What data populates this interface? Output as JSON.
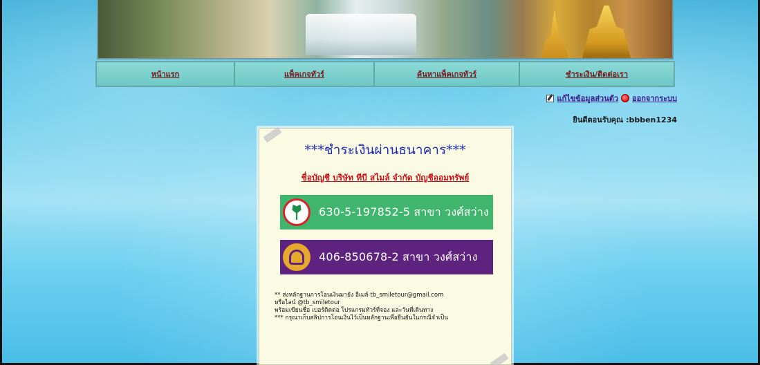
{
  "nav": {
    "items": [
      {
        "label": "หน้าแรก"
      },
      {
        "label": "แพ็คเกจทัวร์"
      },
      {
        "label": "ค้นหาแพ็คเกจทัวร์"
      },
      {
        "label": "ชำระเงิน/ติดต่อเรา"
      }
    ]
  },
  "user": {
    "edit_profile": "แก้ไขข้อมูลส่วนตัว",
    "logout": "ออกจากระบบ",
    "welcome": "ยินดีตอนรับคุณ :bbben1234"
  },
  "payment": {
    "title": "***ชำระเงินผ่านธนาคาร***",
    "account_name": "ชื่อบัญชี บริษัท ทีบี สไมล์ จำกัด  บัญชีออมทรัพย์",
    "banks": [
      {
        "text": "630-5-197852-5  สาขา วงศ์สว่าง",
        "color": "#3fb56d"
      },
      {
        "text": "406-850678-2  สาขา วงศ์สว่าง",
        "color": "#5e237e"
      }
    ],
    "notes": [
      "** ส่งหลักฐานการโอนเงินมายัง อีเมล์ tb_smiletour@gmail.com",
      "หรือไลน์ @tb_smiletour",
      "พร้อมเขียนชื่อ เบอร์ติดต่อ โปรแกรมทัวร์ที่จอง และวันที่เดินทาง",
      "*** กรุณาเก็บสลิปการโอนเงินไว้เป็นหลักฐานเพื่อยืนยันในกรณีจำเป็น"
    ]
  }
}
